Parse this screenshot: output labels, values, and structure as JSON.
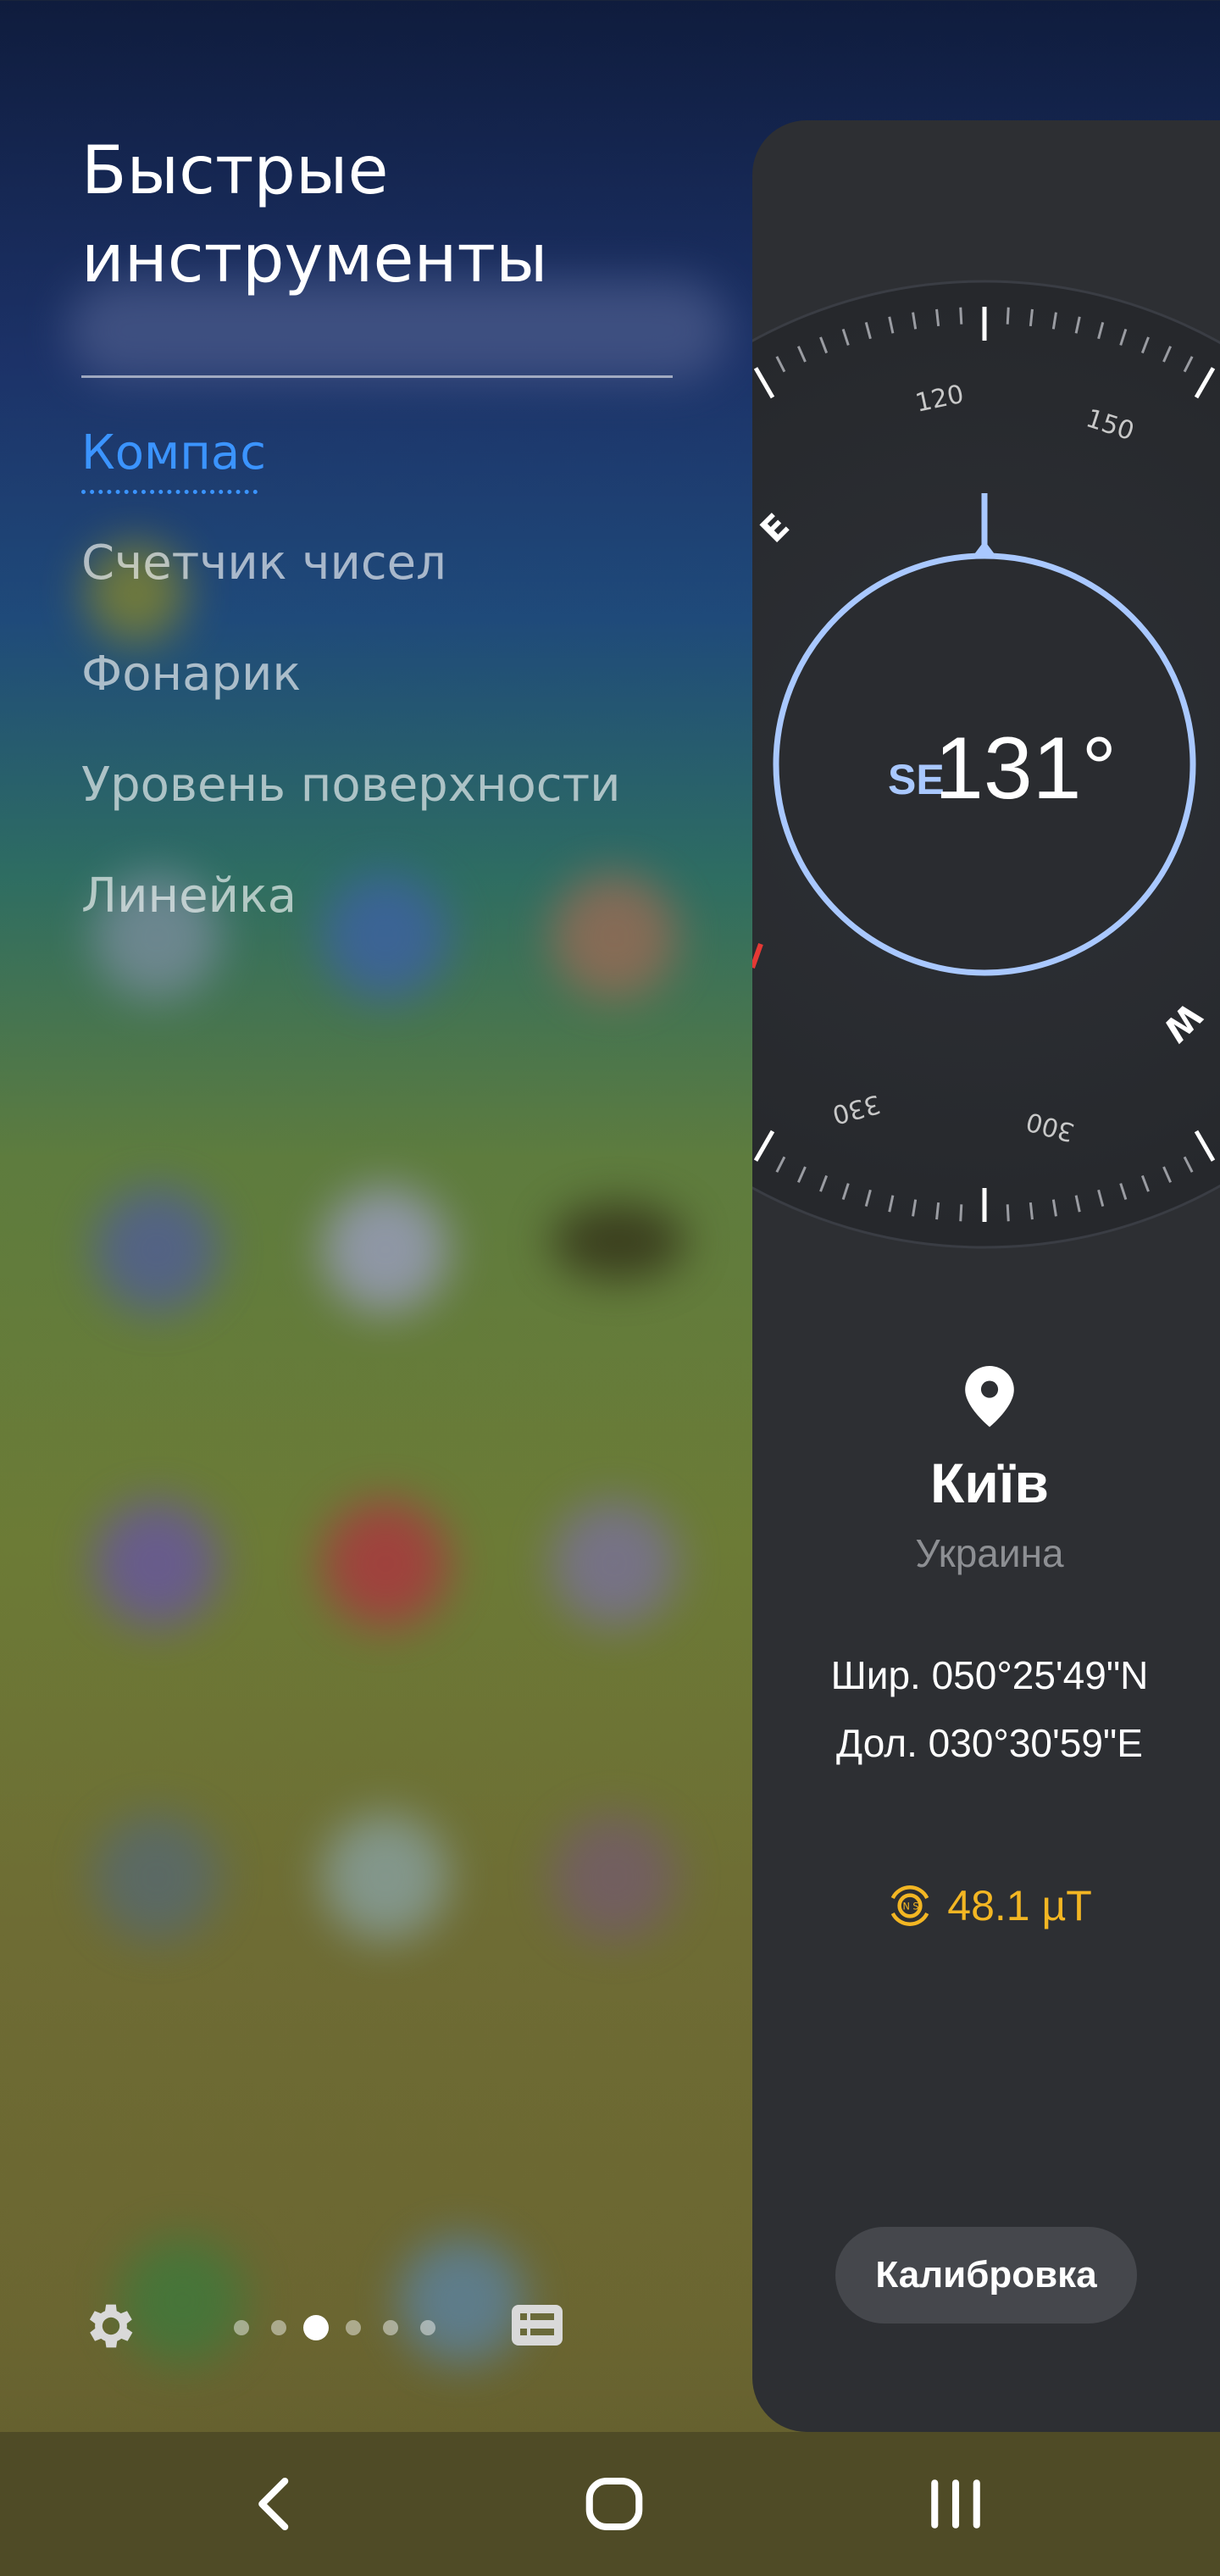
{
  "panel_title": "Быстрые инструменты",
  "menu": {
    "items": [
      {
        "label": "Компас",
        "active": true
      },
      {
        "label": "Счетчик чисел",
        "active": false
      },
      {
        "label": "Фонарик",
        "active": false
      },
      {
        "label": "Уровень поверхности",
        "active": false
      },
      {
        "label": "Линейка",
        "active": false
      }
    ]
  },
  "bottom_bar": {
    "settings_icon": "gear-icon",
    "list_icon": "list-icon",
    "page_count": 6,
    "active_page": 3
  },
  "compass": {
    "direction": "SE",
    "heading": "131°",
    "dial_labels": [
      "120",
      "150",
      "330",
      "300",
      "E",
      "W"
    ],
    "accent_color": "#8fb6ff"
  },
  "location": {
    "pin_icon": "location-pin-icon",
    "city": "Київ",
    "country": "Украина",
    "latitude": "Шир. 050°25'49\"N",
    "longitude": "Дол. 030°30'59\"E"
  },
  "magnetic": {
    "icon": "magnet-sensor-icon",
    "value": "48.1 µT",
    "color": "#f3b623"
  },
  "calibrate_button": "Калибровка",
  "navigation": {
    "back_icon": "back-icon",
    "home_icon": "home-icon",
    "recents_icon": "recents-icon"
  }
}
